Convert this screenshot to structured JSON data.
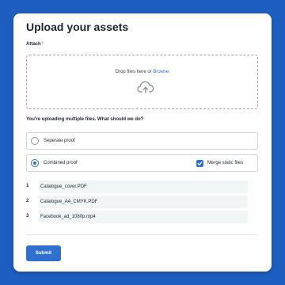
{
  "form": {
    "title": "Upload your assets",
    "attach_label": "Attach",
    "required_mark": "*",
    "dropzone": {
      "text": "Drop files here or",
      "browse_link": "Browse",
      "icon": "cloud-upload-icon"
    },
    "question": "You're uploading multiple files. What should we do?",
    "options": [
      {
        "label": "Seperate proof",
        "selected": false
      },
      {
        "label": "Combined proof",
        "selected": true
      }
    ],
    "merge_checkbox": {
      "label": "Merge static files",
      "checked": true
    },
    "files": [
      {
        "index": "1",
        "name": "Catalogue_cover.PDF"
      },
      {
        "index": "2",
        "name": "Catalogue_A4_CMYK.PDF"
      },
      {
        "index": "3",
        "name": "Facebook_ad_1080p.mp4"
      }
    ],
    "submit_label": "Submit"
  },
  "colors": {
    "background": "#1d5fc1",
    "accent": "#2f6fd0",
    "file_row_bg": "#f0f6f6",
    "required": "#e0494d"
  }
}
